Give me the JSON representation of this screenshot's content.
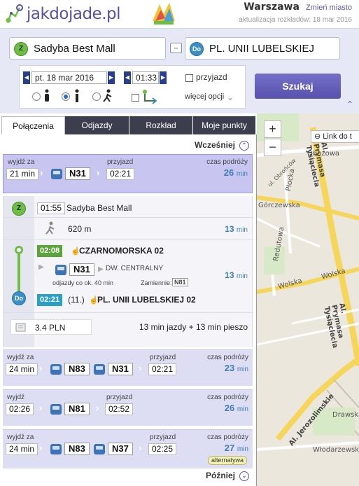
{
  "header": {
    "logo": "jakdojade.pl",
    "city": "Warszawa",
    "change_city": "Zmień miasto",
    "update": "aktualizacja rozkładów: 18 mar 2016"
  },
  "search": {
    "from_badge": "Z",
    "from": "Sadyba Best Mall",
    "to_badge": "Do",
    "to": "PL. UNII LUBELSKIEJ",
    "date": "pt. 18 mar 2016",
    "time": "01:33",
    "arrival_label": "przyjazd",
    "more_options": "więcej opcji",
    "search_button": "Szukaj"
  },
  "tabs": [
    "Połączenia",
    "Odjazdy",
    "Rozkład",
    "Moje punkty"
  ],
  "earlier": "Wcześniej",
  "later": "Później",
  "route1": {
    "leave_label": "wyjdź za",
    "leave": "21 min",
    "line": "N31",
    "arrive_label": "przyjazd",
    "arrive": "02:21",
    "travel_label": "czas podróży",
    "duration": "26",
    "unit": "min"
  },
  "detail": {
    "start_time": "01:55",
    "start_name": "Sadyba Best Mall",
    "walk": "620 m",
    "walk_time": "13",
    "walk_unit": "min",
    "dep_time": "02:08",
    "stop1": "CZARNOMORSKA 02",
    "line": "N31",
    "direction": "DW. CENTRALNY",
    "frequency": "odjazdy co ok. 40 min",
    "substitute_label": "Zamiennie:",
    "substitute": "N81",
    "ride_time": "13",
    "ride_unit": "min",
    "arr_time": "02:21",
    "stops_count": "(11.)",
    "stop2": "PL. UNII LUBELSKIEJ 02",
    "price": "3.4 PLN",
    "summary": "13 min jazdy + 13 min pieszo"
  },
  "route2": {
    "leave_label": "wyjdź za",
    "leave": "24 min",
    "line1": "N83",
    "line2": "N31",
    "arrive_label": "przyjazd",
    "arrive": "02:21",
    "travel_label": "czas podróży",
    "duration": "23",
    "unit": "min"
  },
  "route3": {
    "leave_label": "wyjdź",
    "leave": "02:26",
    "line": "N81",
    "arrive_label": "przyjazd",
    "arrive": "02:52",
    "travel_label": "czas podróży",
    "duration": "26",
    "unit": "min"
  },
  "route4": {
    "leave_label": "wyjdź za",
    "leave": "24 min",
    "line1": "N83",
    "line2": "N37",
    "arrive_label": "przyjazd",
    "arrive": "02:25",
    "travel_label": "czas podróży",
    "duration": "27",
    "unit": "min",
    "tag": "alternatywa"
  },
  "map": {
    "zoom_in": "+",
    "zoom_out": "−",
    "link": "Link do t",
    "streets": [
      "Obozowa",
      "Górczewska",
      "Redutowa",
      "Wolska",
      "Wolska",
      "Płocka",
      "Al. Prymasa Tysiąclecia",
      "Al. Prymasa Tysiąclecia",
      "Al. Jerozolimskie",
      "Drawska",
      "Włodarzewska",
      "ul. Obrońców"
    ]
  }
}
